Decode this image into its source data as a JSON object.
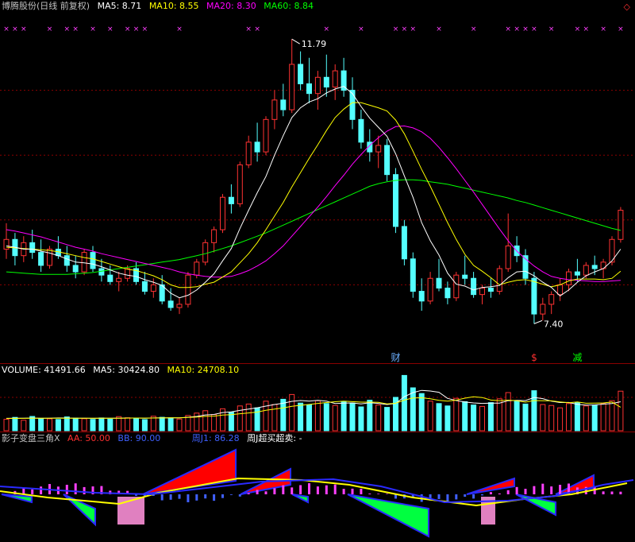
{
  "colors": {
    "up": "#ff3232",
    "down": "#54ffff",
    "ma5": "#ffffff",
    "ma10": "#ffff00",
    "ma20": "#ff00ff",
    "ma60": "#00ff00",
    "grid": "#8b0000"
  },
  "price_panel": {
    "name": "博腾股份(日线 前复权)",
    "ma_labels": [
      {
        "key": "ma5",
        "text": "MA5: 8.71"
      },
      {
        "key": "ma10",
        "text": "MA10: 8.55"
      },
      {
        "key": "ma20",
        "text": "MA20: 8.30"
      },
      {
        "key": "ma60",
        "text": "MA60: 8.84"
      }
    ],
    "high_label": "11.79",
    "low_label": "7.40",
    "event_labels": [
      {
        "text": "财",
        "color": "#6cb0ff"
      },
      {
        "text": "$",
        "color": "#ff3030"
      },
      {
        "text": "减",
        "color": "#00ff00"
      }
    ]
  },
  "volume_panel": {
    "labels": [
      {
        "key": "vol",
        "text": "VOLUME: 41491.66",
        "color": "#ffffff"
      },
      {
        "key": "ma5",
        "text": "MA5: 30424.80",
        "color": "#ffffff"
      },
      {
        "key": "ma10",
        "text": "MA10: 24708.10",
        "color": "#ffff00"
      }
    ]
  },
  "indicator_panel": {
    "labels": [
      {
        "key": "name",
        "text": "影子变盘三角X",
        "color": "#c0c0c0"
      },
      {
        "key": "aa",
        "text": "AA: 50.00",
        "color": "#ff3030"
      },
      {
        "key": "bb",
        "text": "BB: 90.00",
        "color": "#3f60ff"
      },
      {
        "key": "zhouj",
        "text": "周J1: 86.28",
        "color": "#3f60ff"
      },
      {
        "key": "ob",
        "text": "周J超买超卖: -",
        "color": "#ffffff"
      }
    ]
  },
  "chart_data": {
    "type": "candlestick",
    "ylim": [
      7.0,
      12.0
    ],
    "candles": [
      [
        8.55,
        8.95,
        8.4,
        8.7
      ],
      [
        8.7,
        8.8,
        8.3,
        8.45
      ],
      [
        8.45,
        8.75,
        8.35,
        8.65
      ],
      [
        8.65,
        8.85,
        8.4,
        8.5
      ],
      [
        8.5,
        8.7,
        8.2,
        8.3
      ],
      [
        8.3,
        8.6,
        8.25,
        8.55
      ],
      [
        8.55,
        8.75,
        8.4,
        8.45
      ],
      [
        8.45,
        8.6,
        8.2,
        8.3
      ],
      [
        8.3,
        8.45,
        8.1,
        8.2
      ],
      [
        8.2,
        8.55,
        8.15,
        8.5
      ],
      [
        8.5,
        8.6,
        8.2,
        8.25
      ],
      [
        8.25,
        8.4,
        8.05,
        8.15
      ],
      [
        8.15,
        8.3,
        8.0,
        8.05
      ],
      [
        8.05,
        8.2,
        7.9,
        8.1
      ],
      [
        8.1,
        8.3,
        8.05,
        8.25
      ],
      [
        8.25,
        8.35,
        8.0,
        8.05
      ],
      [
        8.05,
        8.2,
        7.85,
        7.9
      ],
      [
        7.9,
        8.1,
        7.8,
        8.0
      ],
      [
        8.0,
        8.15,
        7.7,
        7.75
      ],
      [
        7.75,
        7.95,
        7.6,
        7.65
      ],
      [
        7.65,
        7.8,
        7.55,
        7.7
      ],
      [
        7.7,
        8.2,
        7.65,
        8.15
      ],
      [
        8.15,
        8.4,
        8.1,
        8.35
      ],
      [
        8.35,
        8.7,
        8.3,
        8.65
      ],
      [
        8.65,
        8.9,
        8.5,
        8.85
      ],
      [
        8.85,
        9.4,
        8.8,
        9.35
      ],
      [
        9.35,
        9.55,
        9.1,
        9.25
      ],
      [
        9.25,
        9.9,
        9.2,
        9.85
      ],
      [
        9.85,
        10.3,
        9.8,
        10.2
      ],
      [
        10.2,
        10.5,
        9.9,
        10.05
      ],
      [
        10.05,
        10.6,
        10.0,
        10.55
      ],
      [
        10.55,
        11.0,
        10.4,
        10.85
      ],
      [
        10.85,
        11.1,
        10.6,
        10.7
      ],
      [
        10.7,
        11.79,
        10.65,
        11.4
      ],
      [
        11.4,
        11.6,
        11.0,
        11.1
      ],
      [
        11.1,
        11.5,
        10.8,
        10.95
      ],
      [
        10.95,
        11.3,
        10.7,
        11.2
      ],
      [
        11.2,
        11.55,
        10.9,
        11.05
      ],
      [
        11.05,
        11.4,
        10.85,
        11.3
      ],
      [
        11.3,
        11.5,
        10.9,
        11.0
      ],
      [
        11.0,
        11.2,
        10.4,
        10.55
      ],
      [
        10.55,
        10.7,
        10.1,
        10.2
      ],
      [
        10.2,
        10.4,
        9.9,
        10.05
      ],
      [
        10.05,
        10.3,
        9.8,
        10.15
      ],
      [
        10.15,
        10.25,
        9.6,
        9.7
      ],
      [
        9.7,
        9.8,
        8.8,
        8.9
      ],
      [
        8.9,
        9.0,
        8.3,
        8.4
      ],
      [
        8.4,
        8.5,
        7.8,
        7.9
      ],
      [
        7.9,
        8.1,
        7.6,
        7.75
      ],
      [
        7.75,
        8.2,
        7.7,
        8.1
      ],
      [
        8.1,
        8.4,
        7.9,
        7.95
      ],
      [
        7.95,
        8.05,
        7.7,
        7.8
      ],
      [
        7.8,
        8.2,
        7.75,
        8.15
      ],
      [
        8.15,
        8.45,
        8.0,
        8.1
      ],
      [
        8.1,
        8.2,
        7.8,
        7.85
      ],
      [
        7.85,
        8.0,
        7.7,
        7.95
      ],
      [
        7.95,
        8.1,
        7.8,
        7.9
      ],
      [
        7.9,
        8.3,
        7.85,
        8.25
      ],
      [
        8.25,
        9.1,
        8.2,
        8.6
      ],
      [
        8.6,
        8.75,
        8.35,
        8.45
      ],
      [
        8.45,
        8.55,
        8.0,
        8.1
      ],
      [
        8.1,
        8.2,
        7.4,
        7.55
      ],
      [
        7.55,
        7.8,
        7.45,
        7.7
      ],
      [
        7.7,
        7.9,
        7.55,
        7.85
      ],
      [
        7.85,
        8.1,
        7.75,
        8.0
      ],
      [
        8.0,
        8.25,
        7.9,
        8.2
      ],
      [
        8.2,
        8.4,
        8.05,
        8.15
      ],
      [
        8.15,
        8.35,
        8.1,
        8.3
      ],
      [
        8.3,
        8.45,
        8.15,
        8.25
      ],
      [
        8.25,
        8.4,
        8.1,
        8.35
      ],
      [
        8.35,
        8.75,
        8.3,
        8.7
      ],
      [
        8.7,
        9.2,
        8.65,
        9.15
      ]
    ],
    "ma5": [
      8.6,
      8.58,
      8.55,
      8.55,
      8.52,
      8.49,
      8.45,
      8.4,
      8.35,
      8.34,
      8.32,
      8.28,
      8.23,
      8.18,
      8.15,
      8.13,
      8.08,
      8.04,
      7.99,
      7.87,
      7.8,
      7.84,
      7.92,
      8.04,
      8.17,
      8.37,
      8.56,
      8.87,
      9.15,
      9.42,
      9.67,
      10.0,
      10.3,
      10.58,
      10.73,
      10.82,
      10.87,
      10.96,
      11.02,
      11.06,
      10.95,
      10.75,
      10.57,
      10.43,
      10.29,
      10.02,
      9.68,
      9.35,
      8.96,
      8.68,
      8.46,
      8.18,
      8.01,
      7.98,
      7.92,
      7.96,
      7.97,
      7.99,
      8.11,
      8.2,
      8.21,
      8.14,
      8.04,
      7.96,
      7.83,
      7.92,
      8.04,
      8.14,
      8.2,
      8.25,
      8.37,
      8.55
    ],
    "ma10": [
      8.58,
      8.57,
      8.56,
      8.55,
      8.54,
      8.53,
      8.51,
      8.48,
      8.45,
      8.42,
      8.4,
      8.36,
      8.32,
      8.28,
      8.24,
      8.22,
      8.18,
      8.14,
      8.08,
      8.0,
      7.96,
      7.96,
      7.97,
      8.01,
      8.04,
      8.12,
      8.2,
      8.34,
      8.48,
      8.65,
      8.85,
      9.06,
      9.27,
      9.51,
      9.73,
      9.95,
      10.16,
      10.38,
      10.58,
      10.71,
      10.81,
      10.81,
      10.77,
      10.73,
      10.68,
      10.54,
      10.33,
      10.06,
      9.78,
      9.52,
      9.24,
      8.96,
      8.7,
      8.47,
      8.3,
      8.21,
      8.11,
      8.0,
      8.04,
      8.07,
      8.08,
      8.05,
      8.01,
      7.97,
      8.0,
      8.06,
      8.09,
      8.09,
      8.09,
      8.08,
      8.1,
      8.21
    ],
    "ma20": [
      8.85,
      8.83,
      8.8,
      8.77,
      8.74,
      8.7,
      8.66,
      8.62,
      8.58,
      8.55,
      8.52,
      8.48,
      8.45,
      8.42,
      8.39,
      8.36,
      8.33,
      8.3,
      8.27,
      8.24,
      8.2,
      8.17,
      8.15,
      8.13,
      8.12,
      8.12,
      8.13,
      8.17,
      8.22,
      8.29,
      8.37,
      8.48,
      8.6,
      8.75,
      8.9,
      9.05,
      9.2,
      9.36,
      9.53,
      9.69,
      9.86,
      10.01,
      10.15,
      10.27,
      10.37,
      10.44,
      10.45,
      10.42,
      10.36,
      10.26,
      10.12,
      9.96,
      9.79,
      9.61,
      9.43,
      9.24,
      9.05,
      8.86,
      8.68,
      8.52,
      8.4,
      8.29,
      8.2,
      8.13,
      8.1,
      8.08,
      8.07,
      8.06,
      8.05,
      8.05,
      8.06,
      8.07
    ],
    "ma60": [
      8.2,
      8.19,
      8.18,
      8.17,
      8.16,
      8.16,
      8.16,
      8.16,
      8.17,
      8.18,
      8.19,
      8.21,
      8.23,
      8.25,
      8.27,
      8.29,
      8.31,
      8.33,
      8.35,
      8.37,
      8.39,
      8.42,
      8.45,
      8.48,
      8.52,
      8.56,
      8.6,
      8.65,
      8.7,
      8.75,
      8.8,
      8.86,
      8.92,
      8.98,
      9.04,
      9.1,
      9.16,
      9.22,
      9.28,
      9.34,
      9.4,
      9.46,
      9.52,
      9.56,
      9.59,
      9.61,
      9.62,
      9.62,
      9.61,
      9.59,
      9.57,
      9.55,
      9.52,
      9.49,
      9.46,
      9.43,
      9.4,
      9.37,
      9.34,
      9.3,
      9.27,
      9.23,
      9.19,
      9.15,
      9.11,
      9.07,
      9.03,
      8.99,
      8.95,
      8.91,
      8.87,
      8.84
    ],
    "volume": [
      12000,
      14000,
      11000,
      15000,
      13000,
      12500,
      11800,
      14500,
      13200,
      12600,
      11900,
      13400,
      12100,
      14800,
      13600,
      12800,
      11700,
      15200,
      14100,
      13500,
      12300,
      16000,
      18500,
      21000,
      17000,
      23000,
      19500,
      26000,
      28000,
      24000,
      31000,
      27500,
      33000,
      38000,
      29000,
      27000,
      31500,
      28500,
      26500,
      30500,
      29000,
      25000,
      32000,
      27000,
      24500,
      35000,
      58000,
      45000,
      39000,
      31000,
      28500,
      26000,
      34000,
      30500,
      27000,
      25500,
      29500,
      33500,
      40000,
      31000,
      28000,
      42000,
      27500,
      26500,
      24000,
      28500,
      29500,
      26000,
      27000,
      28500,
      31500,
      41491.66
    ],
    "vol_ma5": [
      13000,
      13200,
      13100,
      13300,
      13000,
      13200,
      13400,
      13300,
      13200,
      13100,
      13000,
      13100,
      13100,
      13200,
      13300,
      13300,
      13200,
      13400,
      13600,
      13600,
      13500,
      14200,
      15000,
      16600,
      17100,
      19100,
      19800,
      21300,
      22700,
      24100,
      25800,
      27500,
      28800,
      30800,
      31700,
      31000,
      31800,
      31000,
      28600,
      29000,
      29200,
      28200,
      29300,
      28700,
      27500,
      28700,
      35700,
      40000,
      42300,
      41700,
      40300,
      33900,
      31700,
      30100,
      29200,
      28700,
      28900,
      29000,
      31500,
      31900,
      31600,
      34900,
      33700,
      31000,
      29600,
      29700,
      27700,
      26900,
      27100,
      27900,
      28600,
      30425
    ],
    "vol_ma10": [
      12800,
      12900,
      13000,
      13100,
      13100,
      13100,
      13200,
      13200,
      13200,
      13200,
      13100,
      13150,
      13150,
      13200,
      13250,
      13300,
      13250,
      13300,
      13450,
      13500,
      13550,
      13900,
      14300,
      15100,
      15300,
      16400,
      16900,
      17800,
      18700,
      19600,
      21500,
      22700,
      23900,
      25700,
      26700,
      27600,
      28700,
      29600,
      30400,
      31100,
      30500,
      30000,
      30000,
      29800,
      28200,
      28800,
      32200,
      34300,
      34600,
      33500,
      31800,
      31000,
      32100,
      34200,
      35700,
      34800,
      32200,
      31500,
      32100,
      31400,
      30000,
      31700,
      31400,
      31300,
      30200,
      29300,
      30200,
      28800,
      29000,
      29200,
      30100,
      24708
    ]
  }
}
